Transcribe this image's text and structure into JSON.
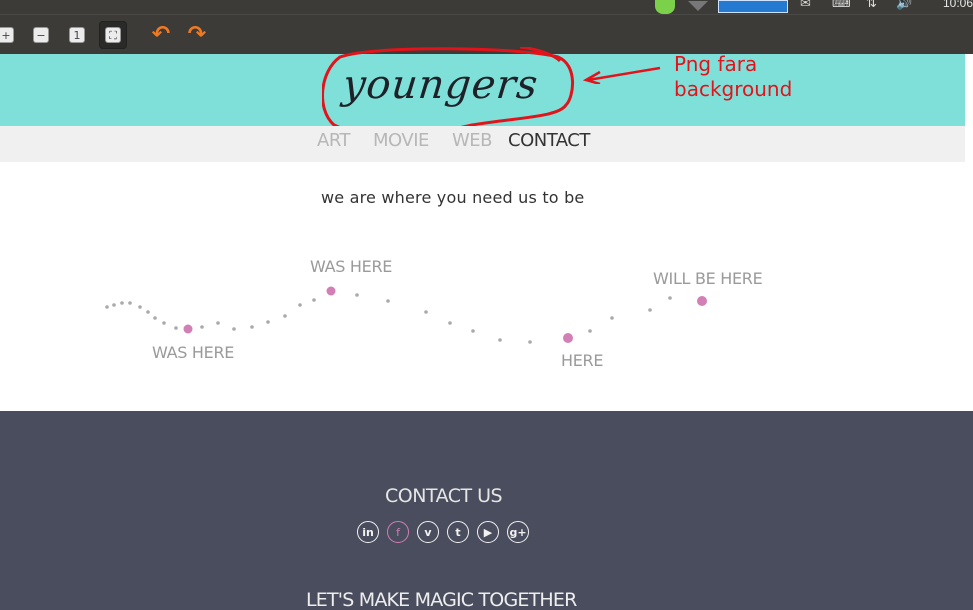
{
  "system_bar": {
    "time": "10:06"
  },
  "toolbar": {
    "buttons": [
      "zoom-in",
      "zoom-out",
      "original-size",
      "fit-window",
      "rotate-left",
      "rotate-right"
    ]
  },
  "header": {
    "logo": "youngers",
    "annotation": [
      "Png fara",
      "background"
    ],
    "bg_color": "#7fe0d9",
    "annotation_color": "#e3131b"
  },
  "nav": {
    "items": [
      "ART",
      "MOVIE",
      "WEB",
      "CONTACT"
    ],
    "current": "CONTACT"
  },
  "main": {
    "tagline": "we are where you need us to be",
    "labels": [
      "WAS HERE",
      "WAS HERE",
      "WILL BE HERE",
      "HERE"
    ],
    "accent_color": "#d27fb6"
  },
  "footer": {
    "contact_title": "CONTACT US",
    "social": [
      {
        "name": "linkedin",
        "glyph": "in"
      },
      {
        "name": "facebook",
        "glyph": "f"
      },
      {
        "name": "vimeo",
        "glyph": "v"
      },
      {
        "name": "tumblr",
        "glyph": "t"
      },
      {
        "name": "youtube",
        "glyph": "▶"
      },
      {
        "name": "google-plus",
        "glyph": "g+"
      }
    ],
    "slogan": "LET'S MAKE MAGIC TOGETHER",
    "bg_color": "#4a4d5d"
  }
}
